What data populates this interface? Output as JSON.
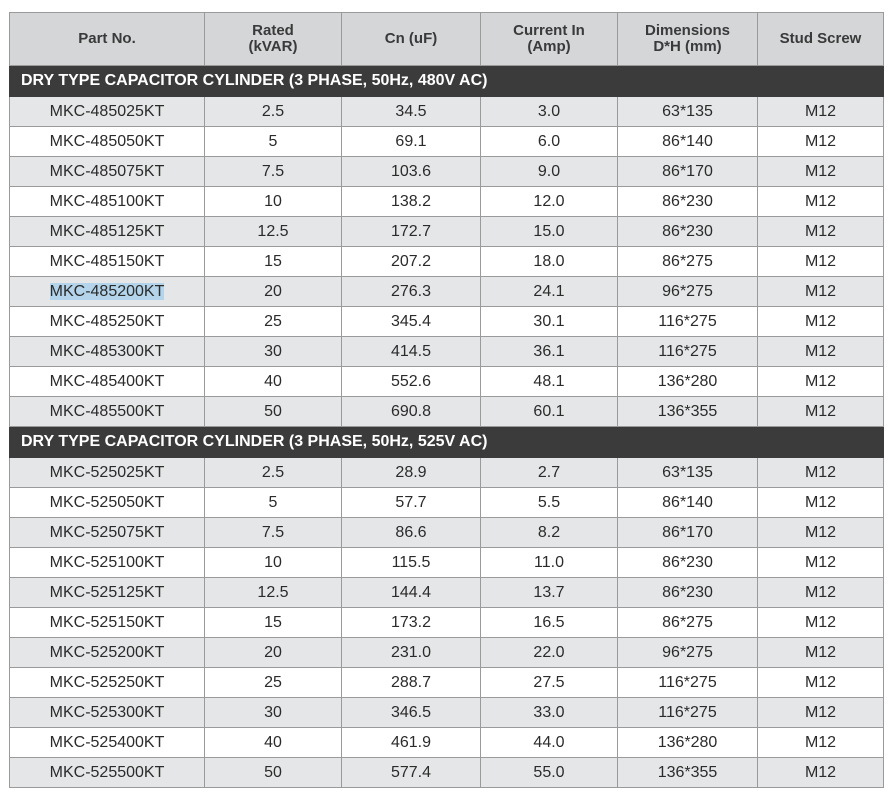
{
  "table": {
    "headers": [
      {
        "line1": "Part No.",
        "line2": ""
      },
      {
        "line1": "Rated",
        "line2": "(kVAR)"
      },
      {
        "line1": "Cn (uF)",
        "line2": ""
      },
      {
        "line1": "Current In",
        "line2": "(Amp)"
      },
      {
        "line1": "Dimensions",
        "line2": "D*H (mm)"
      },
      {
        "line1": "Stud Screw",
        "line2": ""
      }
    ],
    "sections": [
      {
        "title": "DRY TYPE CAPACITOR CYLINDER (3 PHASE, 50Hz, 480V AC)",
        "rows": [
          [
            "MKC-485025KT",
            "2.5",
            "34.5",
            "3.0",
            "63*135",
            "M12"
          ],
          [
            "MKC-485050KT",
            "5",
            "69.1",
            "6.0",
            "86*140",
            "M12"
          ],
          [
            "MKC-485075KT",
            "7.5",
            "103.6",
            "9.0",
            "86*170",
            "M12"
          ],
          [
            "MKC-485100KT",
            "10",
            "138.2",
            "12.0",
            "86*230",
            "M12"
          ],
          [
            "MKC-485125KT",
            "12.5",
            "172.7",
            "15.0",
            "86*230",
            "M12"
          ],
          [
            "MKC-485150KT",
            "15",
            "207.2",
            "18.0",
            "86*275",
            "M12"
          ],
          [
            "MKC-485200KT",
            "20",
            "276.3",
            "24.1",
            "96*275",
            "M12"
          ],
          [
            "MKC-485250KT",
            "25",
            "345.4",
            "30.1",
            "116*275",
            "M12"
          ],
          [
            "MKC-485300KT",
            "30",
            "414.5",
            "36.1",
            "116*275",
            "M12"
          ],
          [
            "MKC-485400KT",
            "40",
            "552.6",
            "48.1",
            "136*280",
            "M12"
          ],
          [
            "MKC-485500KT",
            "50",
            "690.8",
            "60.1",
            "136*355",
            "M12"
          ]
        ]
      },
      {
        "title": "DRY TYPE CAPACITOR CYLINDER (3 PHASE, 50Hz, 525V AC)",
        "rows": [
          [
            "MKC-525025KT",
            "2.5",
            "28.9",
            "2.7",
            "63*135",
            "M12"
          ],
          [
            "MKC-525050KT",
            "5",
            "57.7",
            "5.5",
            "86*140",
            "M12"
          ],
          [
            "MKC-525075KT",
            "7.5",
            "86.6",
            "8.2",
            "86*170",
            "M12"
          ],
          [
            "MKC-525100KT",
            "10",
            "115.5",
            "11.0",
            "86*230",
            "M12"
          ],
          [
            "MKC-525125KT",
            "12.5",
            "144.4",
            "13.7",
            "86*230",
            "M12"
          ],
          [
            "MKC-525150KT",
            "15",
            "173.2",
            "16.5",
            "86*275",
            "M12"
          ],
          [
            "MKC-525200KT",
            "20",
            "231.0",
            "22.0",
            "96*275",
            "M12"
          ],
          [
            "MKC-525250KT",
            "25",
            "288.7",
            "27.5",
            "116*275",
            "M12"
          ],
          [
            "MKC-525300KT",
            "30",
            "346.5",
            "33.0",
            "116*275",
            "M12"
          ],
          [
            "MKC-525400KT",
            "40",
            "461.9",
            "44.0",
            "136*280",
            "M12"
          ],
          [
            "MKC-525500KT",
            "50",
            "577.4",
            "55.0",
            "136*355",
            "M12"
          ]
        ]
      }
    ],
    "selected_text": "MKC-485200KT"
  },
  "colors": {
    "header_bg": "#d4d6d8",
    "section_bg": "#3b3b3b",
    "row_alt_bg": "#e5e6e7",
    "selection_bg": "#b3d4ea"
  }
}
